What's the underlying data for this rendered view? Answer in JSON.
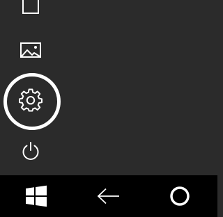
{
  "start_menu": {
    "items": [
      {
        "icon": "documents-icon"
      },
      {
        "icon": "pictures-icon"
      },
      {
        "icon": "settings-gear-icon",
        "highlighted": true
      },
      {
        "icon": "power-icon"
      }
    ]
  },
  "taskbar": {
    "buttons": [
      {
        "icon": "windows-logo-icon"
      },
      {
        "icon": "back-arrow-icon"
      },
      {
        "icon": "cortana-search-icon"
      }
    ]
  },
  "colors": {
    "panel_bg": "#2b2b2b",
    "taskbar_bg": "#000000",
    "icon": "#ffffff",
    "highlight_ring": "#ffffff"
  }
}
